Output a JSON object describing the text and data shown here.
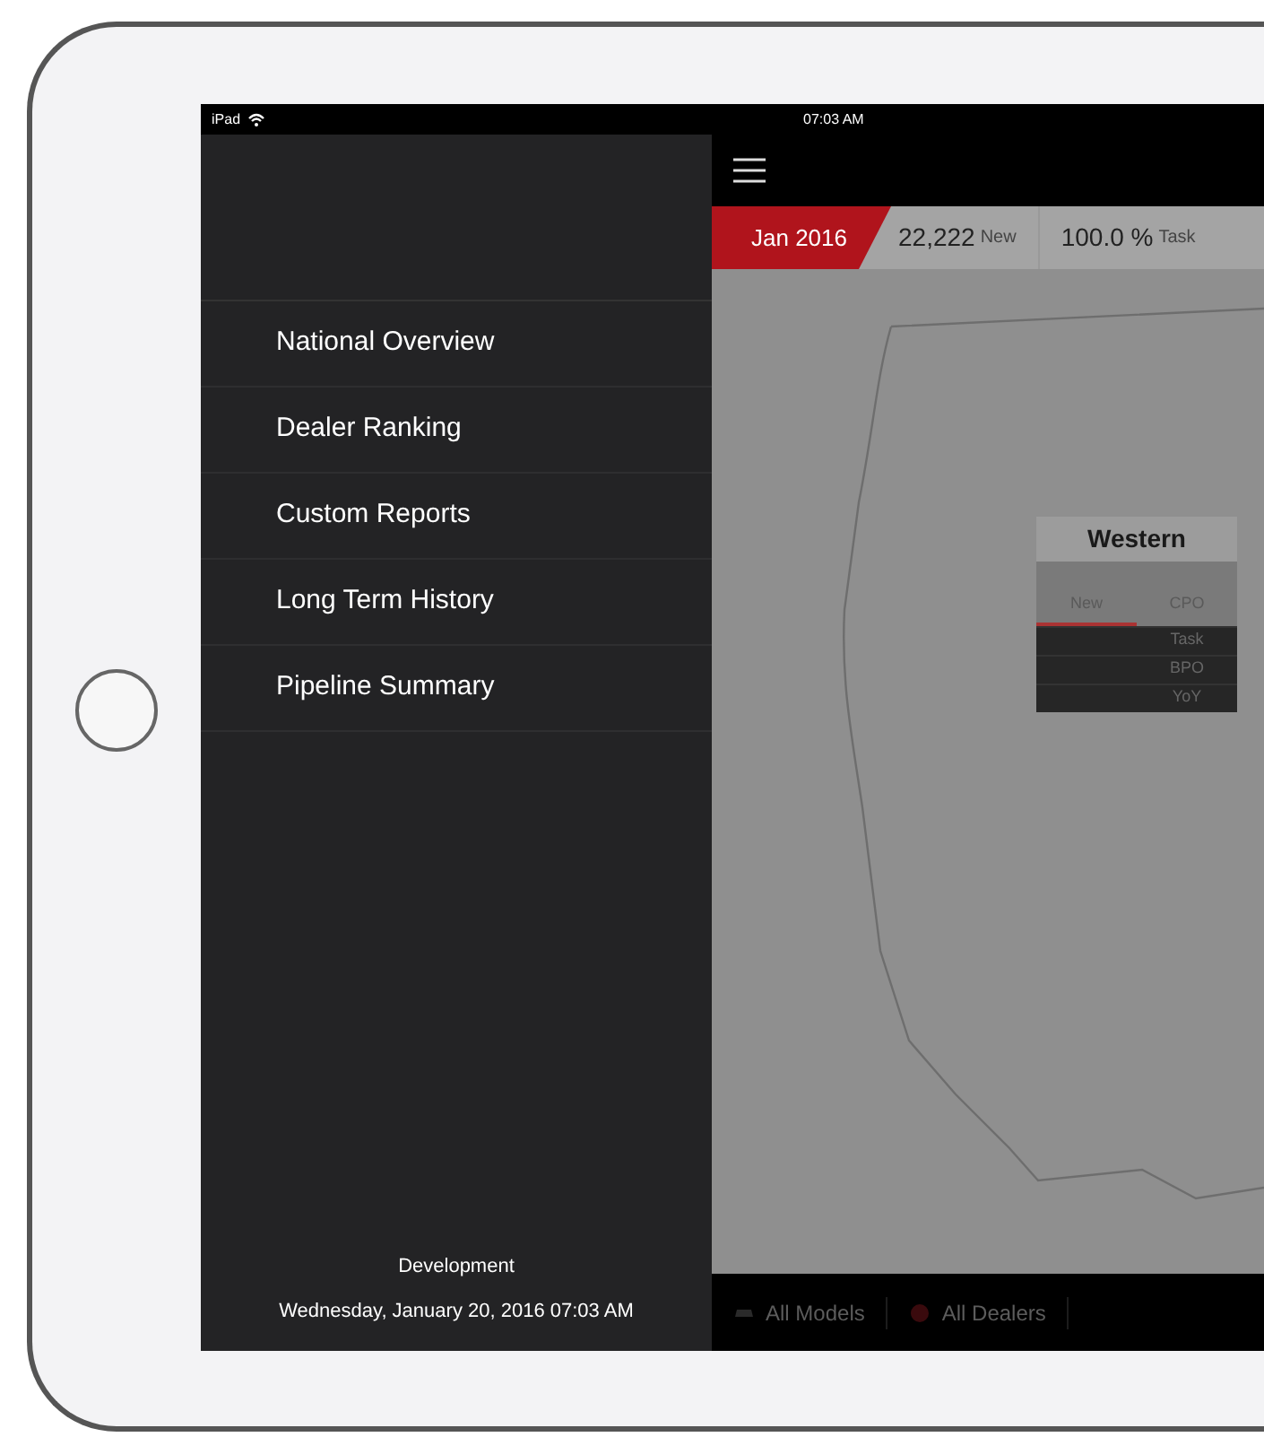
{
  "status_bar": {
    "device": "iPad",
    "time": "07:03 AM"
  },
  "sidebar": {
    "items": [
      {
        "label": "National Overview"
      },
      {
        "label": "Dealer Ranking"
      },
      {
        "label": "Custom Reports"
      },
      {
        "label": "Long Term History"
      },
      {
        "label": "Pipeline Summary"
      }
    ],
    "footer": {
      "environment": "Development",
      "timestamp": "Wednesday, January 20, 2016 07:03 AM"
    }
  },
  "summary_bar": {
    "period": "Jan 2016",
    "metrics": [
      {
        "value": "22,222",
        "label": "New"
      },
      {
        "value": "100.0 %",
        "label": "Task"
      }
    ]
  },
  "map": {
    "region_popup": {
      "title": "Western",
      "tabs": [
        {
          "label": "New",
          "selected": true
        },
        {
          "label": "CPO",
          "selected": false
        }
      ],
      "rows": [
        {
          "label": "Task"
        },
        {
          "label": "BPO"
        },
        {
          "label": "YoY"
        }
      ]
    }
  },
  "filters": [
    {
      "label": "All Models",
      "kind": "models"
    },
    {
      "label": "All Dealers",
      "kind": "dealers"
    }
  ]
}
